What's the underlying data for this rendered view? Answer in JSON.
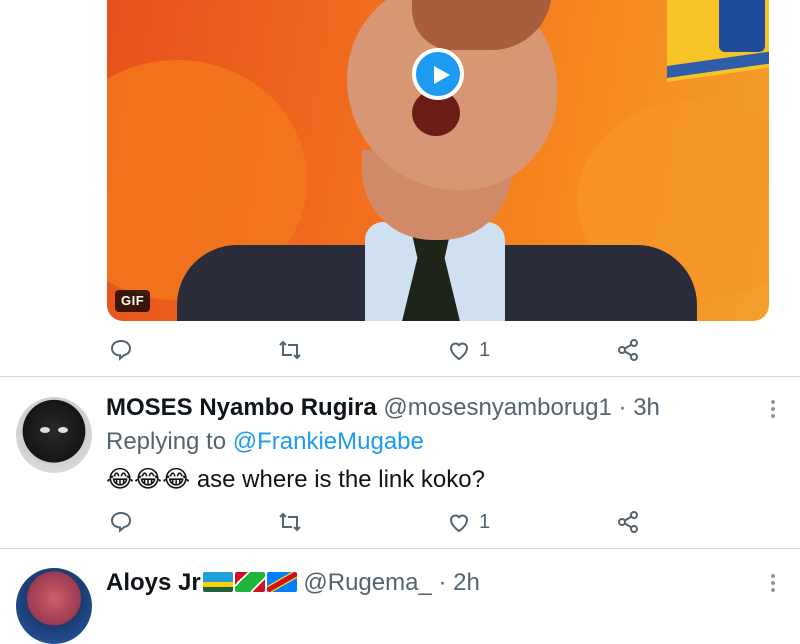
{
  "media": {
    "badge": "GIF"
  },
  "tweet_main": {
    "like_count": "1"
  },
  "reply1": {
    "name": "MOSES Nyambo Rugira",
    "handle": "@mosesnyamborug1",
    "separator": "·",
    "time": "3h",
    "replying_prefix": "Replying to",
    "replying_handle": "@FrankieMugabe",
    "emojis": "😂😂😂",
    "text": "ase where is the link koko?",
    "like_count": "1"
  },
  "reply2": {
    "name": "Aloys Jr",
    "flags": [
      "rwanda-flag",
      "burundi-flag",
      "drc-flag"
    ],
    "handle": "@Rugema_",
    "separator": "·",
    "time": "2h"
  },
  "colors": {
    "accent": "#1d9bf0",
    "muted": "#536471",
    "divider": "#cfd9de"
  },
  "icons": [
    "play-icon",
    "reply-icon",
    "retweet-icon",
    "like-icon",
    "share-icon",
    "more-icon"
  ]
}
